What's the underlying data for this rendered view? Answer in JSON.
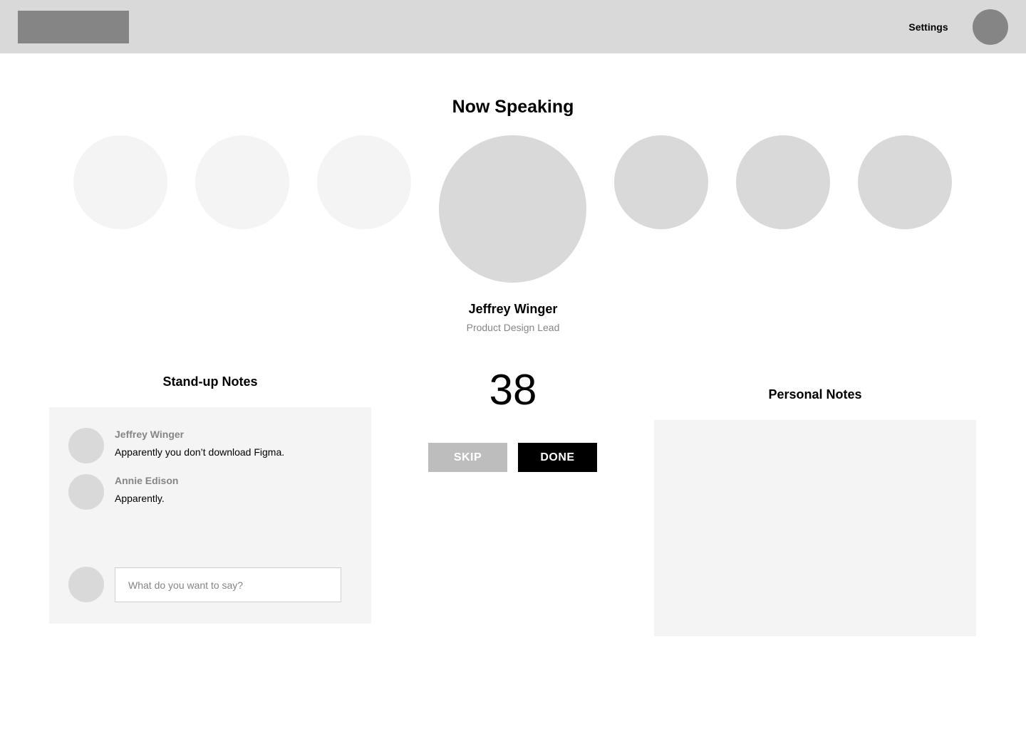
{
  "header": {
    "logo": "logo-placeholder",
    "settings_label": "Settings",
    "user_avatar": "user-avatar"
  },
  "speaking": {
    "heading": "Now Speaking",
    "current_speaker": {
      "name": "Jeffrey Winger",
      "role": "Product Design Lead"
    },
    "queue_before_count": 3,
    "queue_after_count": 3
  },
  "timer": {
    "value": "38"
  },
  "actions": {
    "skip_label": "SKIP",
    "done_label": "DONE"
  },
  "standup_notes": {
    "title": "Stand-up Notes",
    "messages": [
      {
        "author": "Jeffrey Winger",
        "text": "Apparently you don’t download Figma."
      },
      {
        "author": "Annie Edison",
        "text": "Apparently."
      }
    ],
    "input": {
      "placeholder": "What do you want to say?",
      "value": ""
    }
  },
  "personal_notes": {
    "title": "Personal Notes",
    "value": ""
  },
  "colors": {
    "header_bg": "#d9d9d9",
    "placeholder_dark": "#858585",
    "avatar_light": "#f4f4f4",
    "avatar_mid": "#d9d9d9",
    "panel_bg": "#f4f4f4",
    "skip_bg": "#bdbdbd",
    "done_bg": "#000000"
  }
}
